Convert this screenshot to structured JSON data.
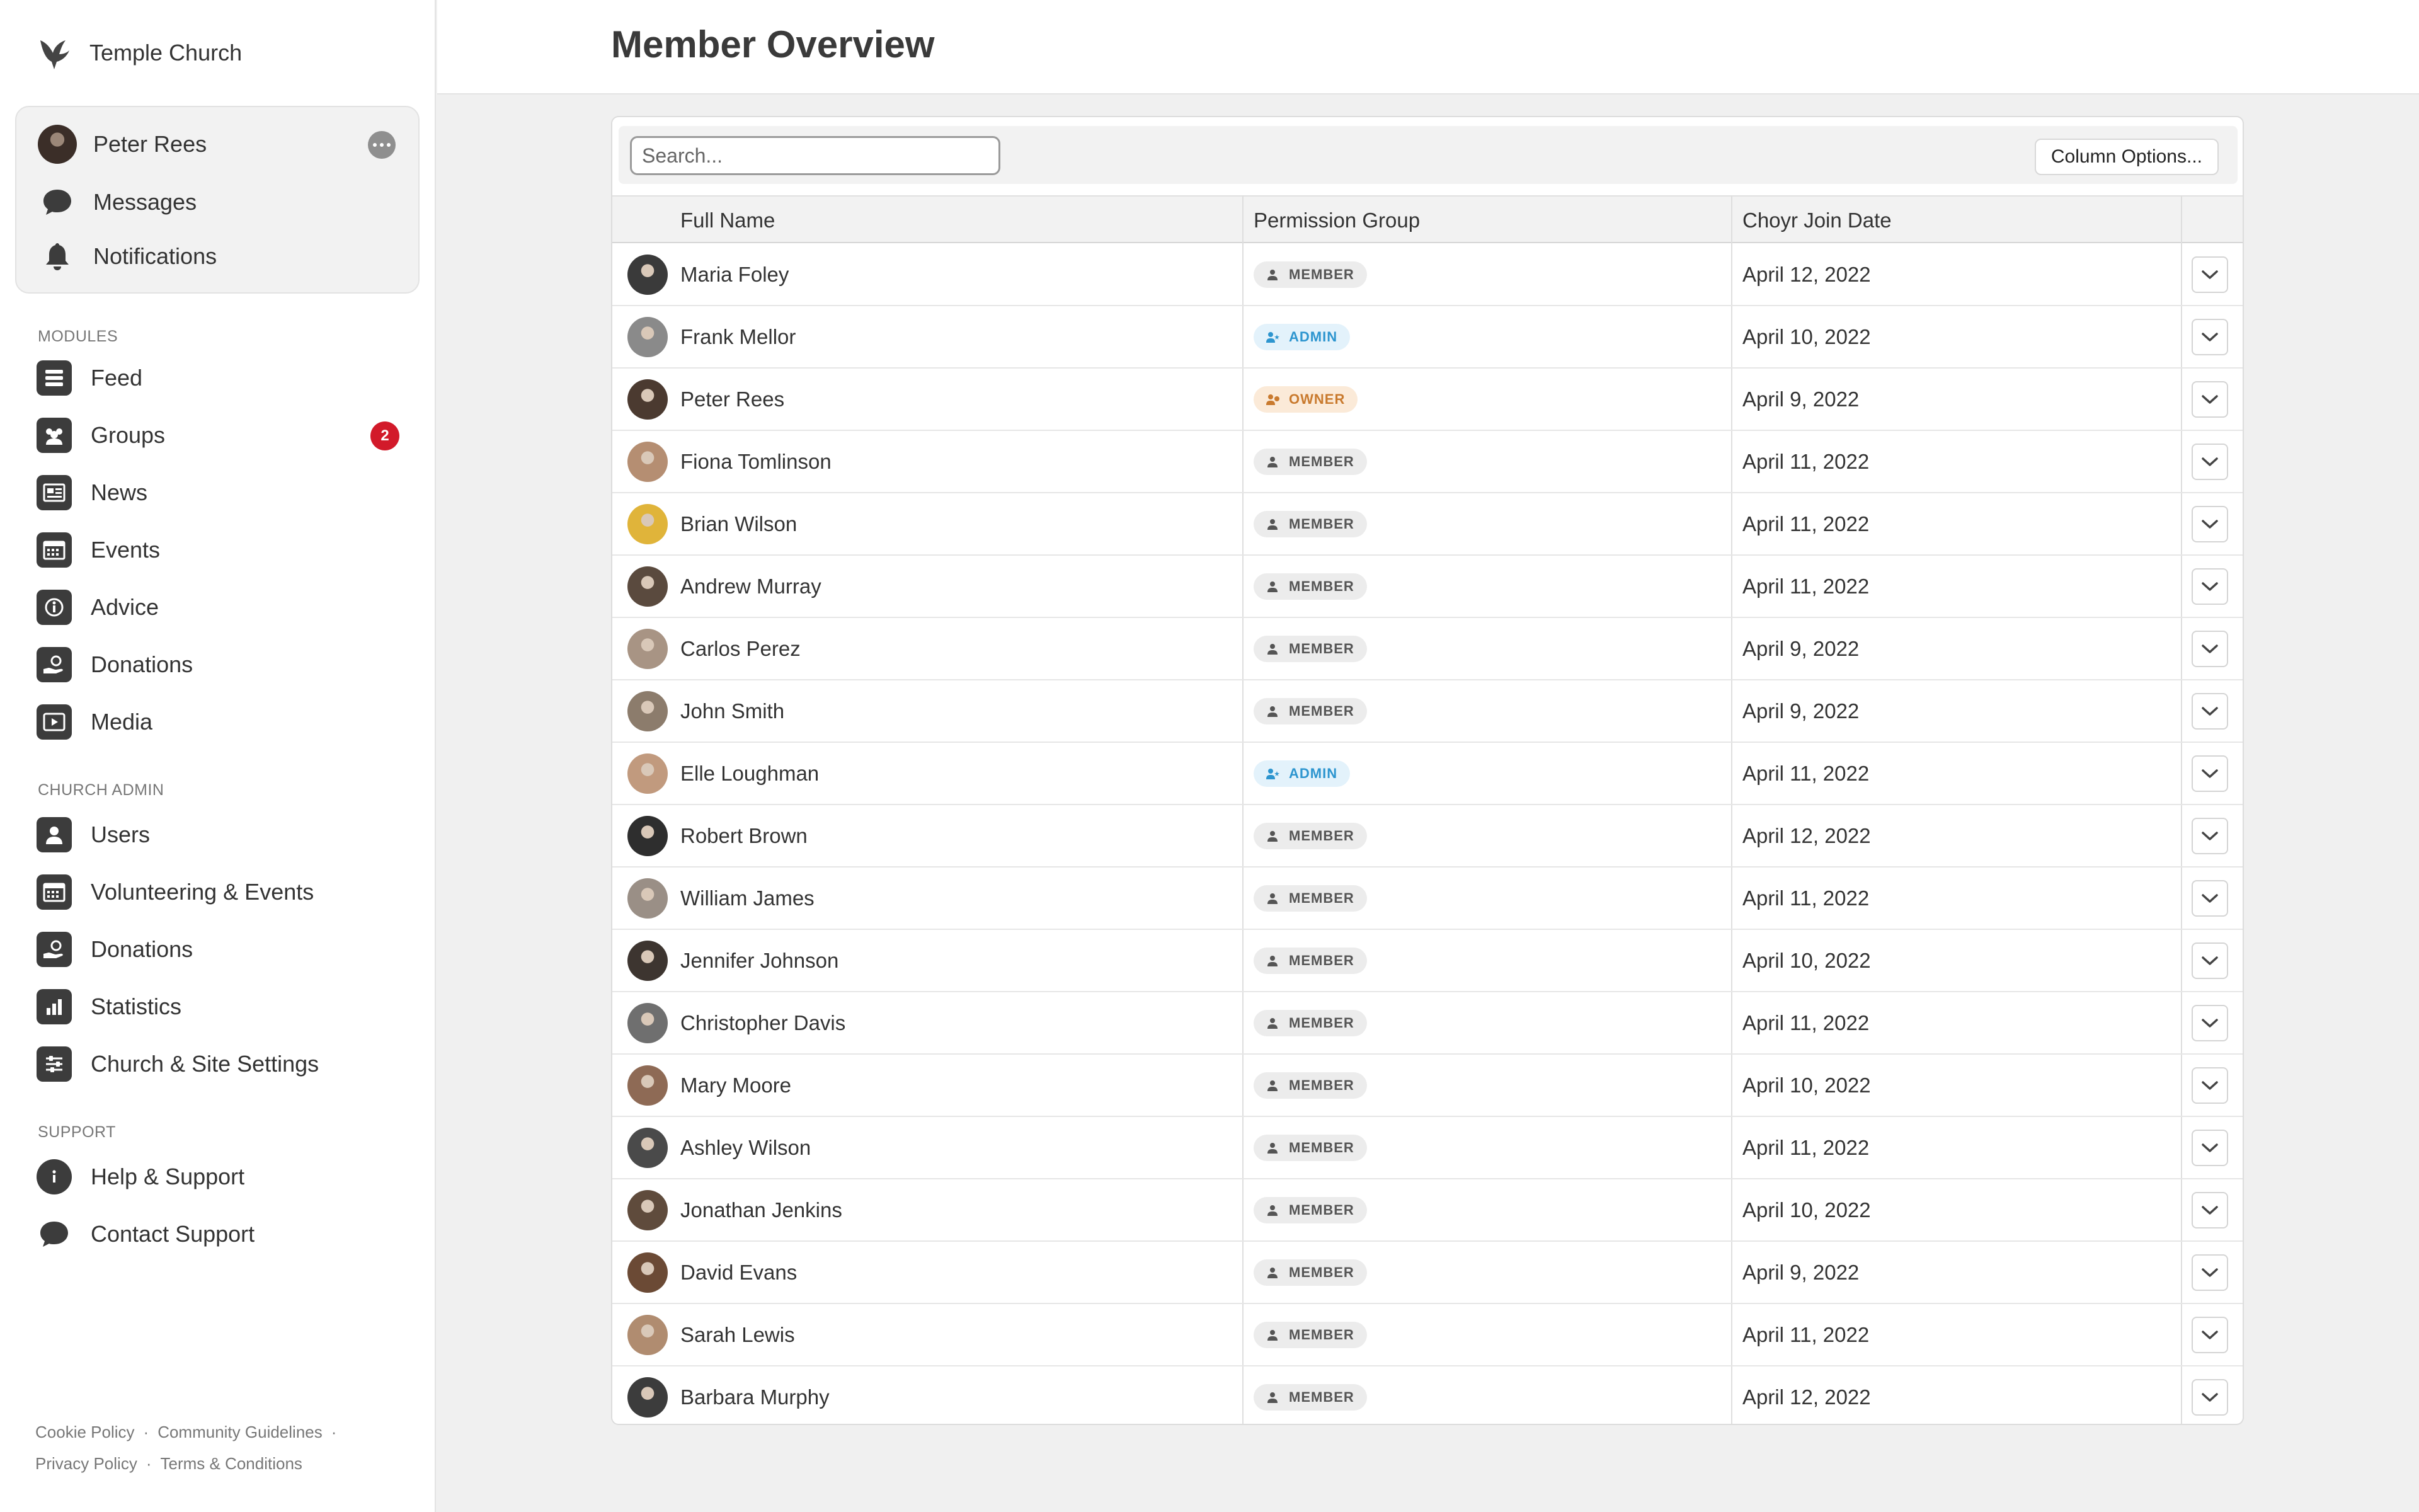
{
  "brand": {
    "name": "Temple Church",
    "icon": "bird-logo-icon"
  },
  "user_card": {
    "user_name": "Peter Rees",
    "messages_label": "Messages",
    "notifications_label": "Notifications"
  },
  "sidebar": {
    "modules_title": "MODULES",
    "modules": [
      {
        "label": "Feed",
        "icon": "feed-icon"
      },
      {
        "label": "Groups",
        "icon": "groups-icon",
        "badge": "2"
      },
      {
        "label": "News",
        "icon": "news-icon"
      },
      {
        "label": "Events",
        "icon": "events-icon"
      },
      {
        "label": "Advice",
        "icon": "advice-icon"
      },
      {
        "label": "Donations",
        "icon": "donations-icon"
      },
      {
        "label": "Media",
        "icon": "media-icon"
      }
    ],
    "admin_title": "CHURCH ADMIN",
    "admin": [
      {
        "label": "Users",
        "icon": "users-icon"
      },
      {
        "label": "Volunteering & Events",
        "icon": "volunteering-icon"
      },
      {
        "label": "Donations",
        "icon": "donations-icon"
      },
      {
        "label": "Statistics",
        "icon": "statistics-icon"
      },
      {
        "label": "Church & Site Settings",
        "icon": "settings-icon"
      }
    ],
    "support_title": "SUPPORT",
    "support": [
      {
        "label": "Help & Support",
        "icon": "info-icon"
      },
      {
        "label": "Contact Support",
        "icon": "chat-icon"
      }
    ],
    "footer": {
      "cookie": "Cookie Policy",
      "guidelines": "Community Guidelines",
      "privacy": "Privacy Policy",
      "terms": "Terms & Conditions",
      "separator": "·"
    }
  },
  "header": {
    "title": "Member Overview"
  },
  "toolbar": {
    "search_placeholder": "Search...",
    "column_options_label": "Column Options..."
  },
  "table": {
    "columns": [
      "Full Name",
      "Permission Group",
      "Choyr Join Date"
    ],
    "rows": [
      {
        "name": "Maria Foley",
        "group": "MEMBER",
        "date": "April 12, 2022"
      },
      {
        "name": "Frank Mellor",
        "group": "ADMIN",
        "date": "April 10, 2022"
      },
      {
        "name": "Peter Rees",
        "group": "OWNER",
        "date": "April 9, 2022"
      },
      {
        "name": "Fiona Tomlinson",
        "group": "MEMBER",
        "date": "April 11, 2022"
      },
      {
        "name": "Brian Wilson",
        "group": "MEMBER",
        "date": "April 11, 2022"
      },
      {
        "name": "Andrew Murray",
        "group": "MEMBER",
        "date": "April 11, 2022"
      },
      {
        "name": "Carlos Perez",
        "group": "MEMBER",
        "date": "April 9, 2022"
      },
      {
        "name": "John Smith",
        "group": "MEMBER",
        "date": "April 9, 2022"
      },
      {
        "name": "Elle Loughman",
        "group": "ADMIN",
        "date": "April 11, 2022"
      },
      {
        "name": "Robert Brown",
        "group": "MEMBER",
        "date": "April 12, 2022"
      },
      {
        "name": "William James",
        "group": "MEMBER",
        "date": "April 11, 2022"
      },
      {
        "name": "Jennifer Johnson",
        "group": "MEMBER",
        "date": "April 10, 2022"
      },
      {
        "name": "Christopher Davis",
        "group": "MEMBER",
        "date": "April 11, 2022"
      },
      {
        "name": "Mary Moore",
        "group": "MEMBER",
        "date": "April 10, 2022"
      },
      {
        "name": "Ashley Wilson",
        "group": "MEMBER",
        "date": "April 11, 2022"
      },
      {
        "name": "Jonathan Jenkins",
        "group": "MEMBER",
        "date": "April 10, 2022"
      },
      {
        "name": "David Evans",
        "group": "MEMBER",
        "date": "April 9, 2022"
      },
      {
        "name": "Sarah Lewis",
        "group": "MEMBER",
        "date": "April 11, 2022"
      },
      {
        "name": "Barbara Murphy",
        "group": "MEMBER",
        "date": "April 12, 2022"
      }
    ]
  },
  "colors": {
    "badge_red": "#d21a2a",
    "admin_blue": "#2d95cf",
    "owner_orange": "#c97a2e"
  }
}
